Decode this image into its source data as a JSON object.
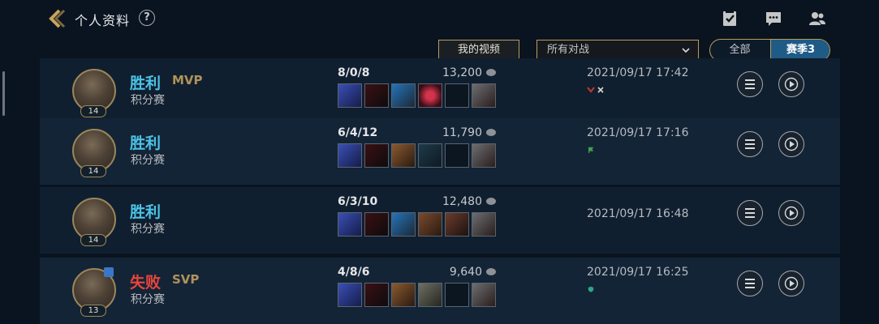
{
  "header": {
    "title": "个人资料",
    "help_label": "?",
    "icons": [
      "task-icon",
      "chat-icon",
      "friends-icon"
    ]
  },
  "filters": {
    "video_button": "我的视频",
    "mode_dropdown": "所有对战",
    "season_options": [
      "全部",
      "赛季3"
    ],
    "selected_season": "赛季3"
  },
  "matches": [
    {
      "result": "胜利",
      "result_type": "win",
      "badge": "MVP",
      "mode": "积分赛",
      "level": "14",
      "kda": "8/0/8",
      "gold": "13,200",
      "datetime": "2021/09/17 17:42",
      "items": [
        "blue-sword",
        "dark-blade",
        "blue-crossbow",
        "red-gem",
        "empty",
        "trinket"
      ]
    },
    {
      "result": "胜利",
      "result_type": "win",
      "badge": "",
      "mode": "积分赛",
      "level": "14",
      "kda": "6/4/12",
      "gold": "11,790",
      "datetime": "2021/09/17 17:16",
      "items": [
        "blue-sword",
        "dark-blade",
        "hammer",
        "spear",
        "empty",
        "trinket"
      ]
    },
    {
      "result": "胜利",
      "result_type": "win",
      "badge": "",
      "mode": "积分赛",
      "level": "14",
      "kda": "6/3/10",
      "gold": "12,480",
      "datetime": "2021/09/17 16:48",
      "items": [
        "blue-sword",
        "dark-blade",
        "blue-crossbow",
        "book",
        "gauntlet",
        "trinket"
      ]
    },
    {
      "result": "失败",
      "result_type": "loss",
      "badge": "SVP",
      "mode": "积分赛",
      "level": "13",
      "kda": "4/8/6",
      "gold": "9,640",
      "datetime": "2021/09/17 16:25",
      "items": [
        "blue-sword",
        "dark-blade",
        "hammer",
        "greatsword",
        "empty",
        "trinket"
      ]
    }
  ],
  "colors": {
    "win": "#4bc3e6",
    "loss": "#e8453c",
    "gold_border": "#b89c5c",
    "selected_tab": "#1f5b87"
  }
}
